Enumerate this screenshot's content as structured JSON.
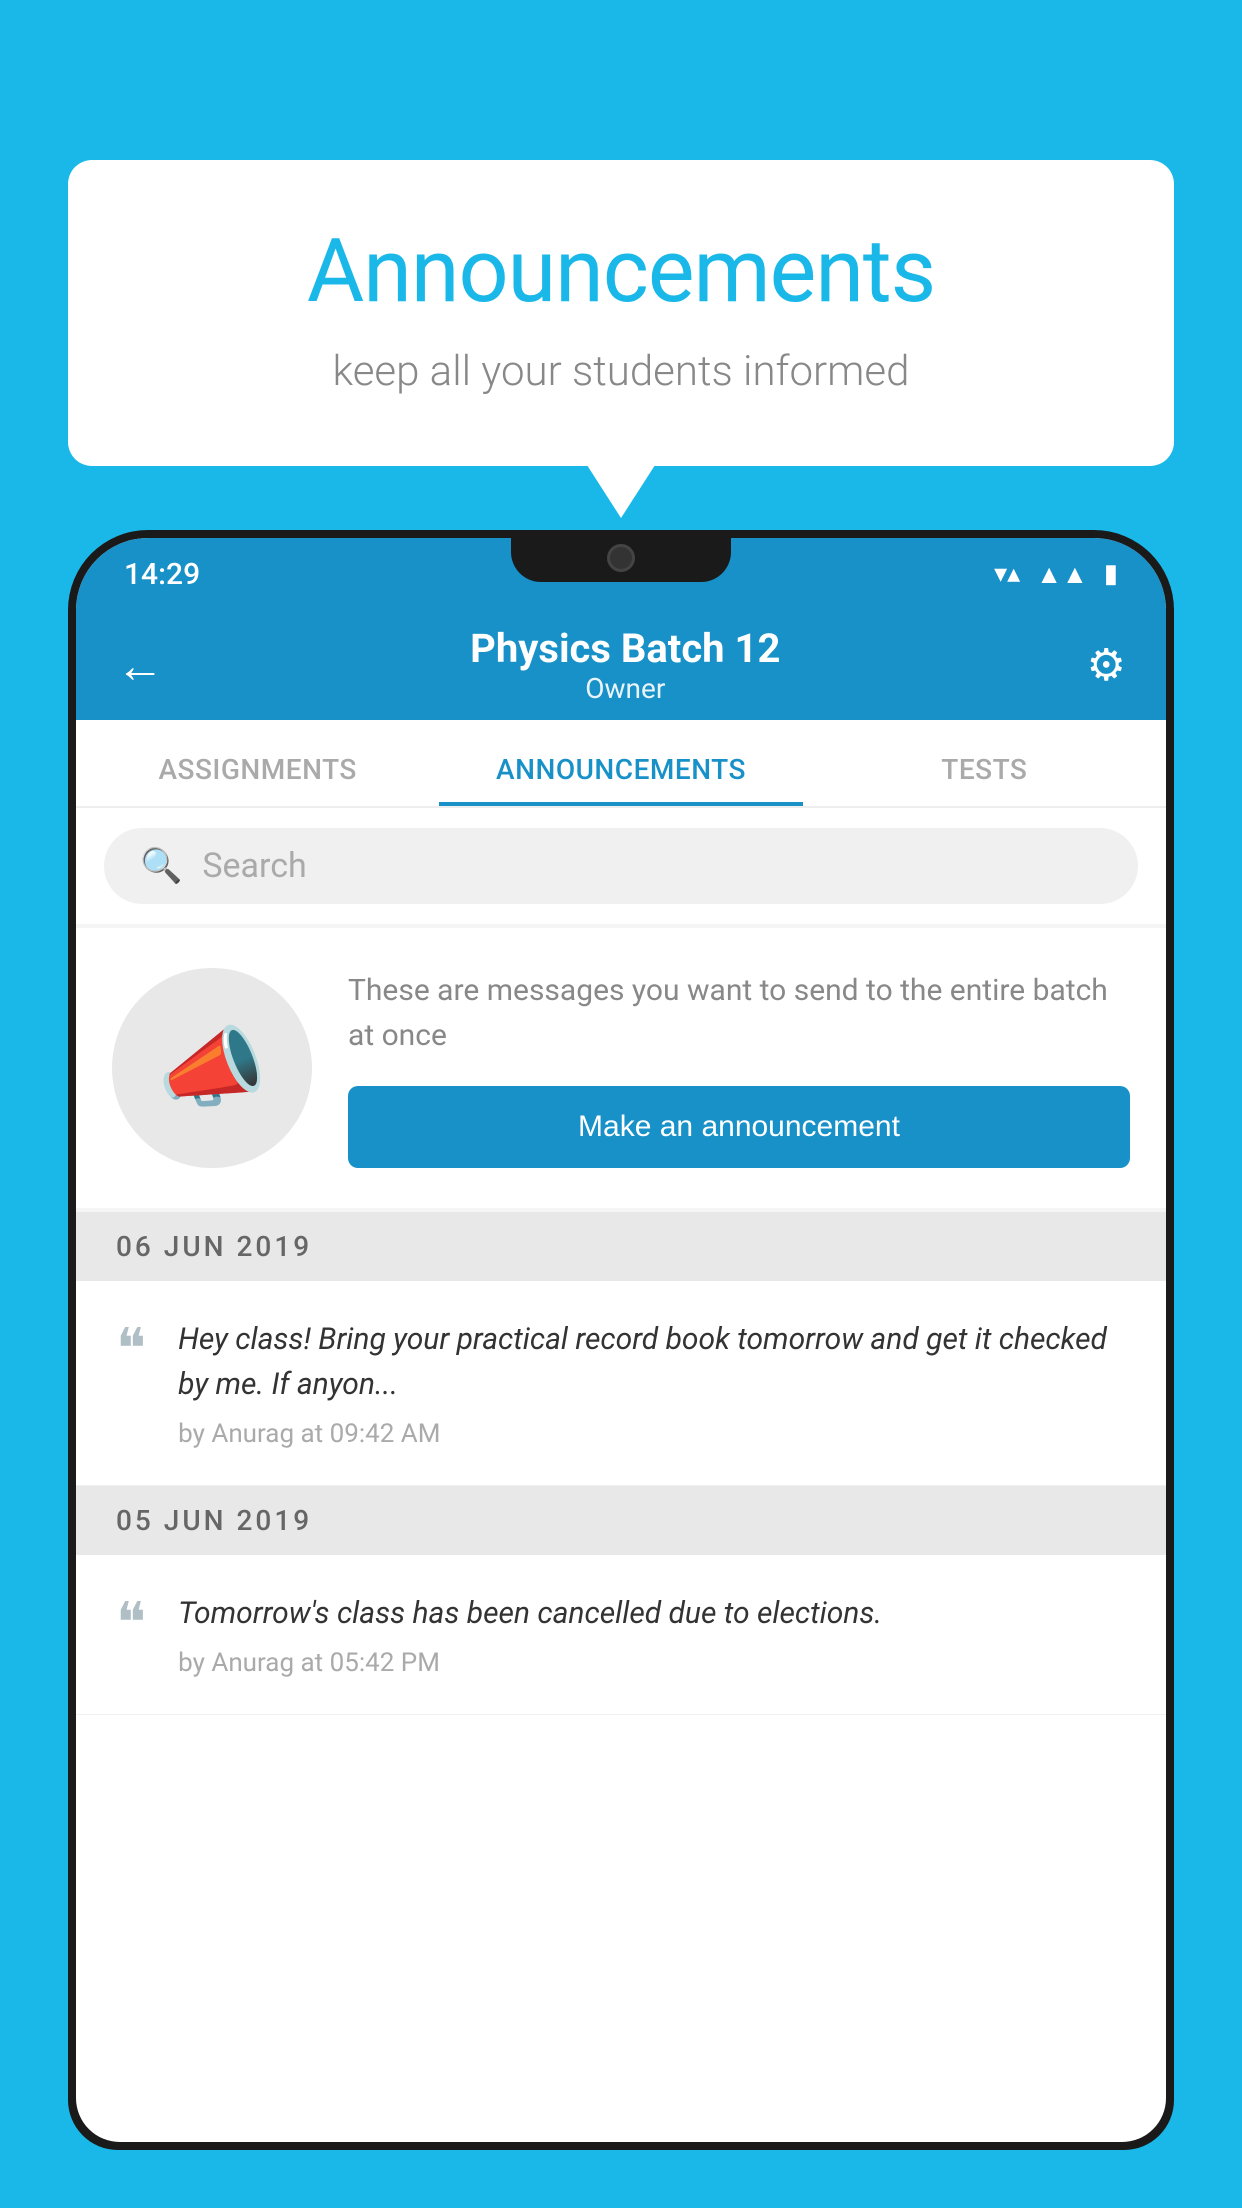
{
  "background": {
    "color": "#1ab8e8"
  },
  "speech_bubble": {
    "title": "Announcements",
    "subtitle": "keep all your students informed"
  },
  "phone": {
    "status_bar": {
      "time": "14:29",
      "wifi": "▼",
      "signal": "▲",
      "battery": "▮"
    },
    "app_bar": {
      "title": "Physics Batch 12",
      "subtitle": "Owner",
      "back_label": "←",
      "settings_label": "⚙"
    },
    "tabs": [
      {
        "label": "ASSIGNMENTS",
        "active": false
      },
      {
        "label": "ANNOUNCEMENTS",
        "active": true
      },
      {
        "label": "TESTS",
        "active": false
      },
      {
        "label": "...",
        "active": false
      }
    ],
    "search": {
      "placeholder": "Search"
    },
    "promo": {
      "description": "These are messages you want to send to the entire batch at once",
      "button_label": "Make an announcement"
    },
    "announcements": [
      {
        "date": "06  JUN  2019",
        "text": "Hey class! Bring your practical record book tomorrow and get it checked by me. If anyon...",
        "meta": "by Anurag at 09:42 AM"
      },
      {
        "date": "05  JUN  2019",
        "text": "Tomorrow's class has been cancelled due to elections.",
        "meta": "by Anurag at 05:42 PM"
      }
    ]
  }
}
